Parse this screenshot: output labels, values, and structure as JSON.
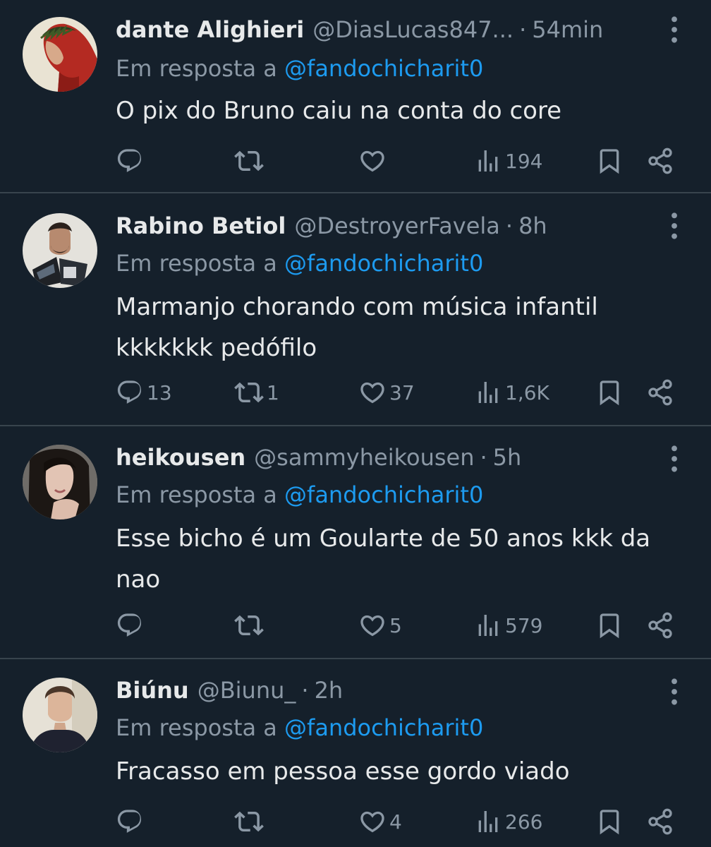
{
  "reply_prefix": "Em resposta a",
  "colors": {
    "background": "#15202b",
    "text": "#e7e9ea",
    "muted": "#8b98a5",
    "accent": "#1d9bf0",
    "divider": "#38444d"
  },
  "tweets": [
    {
      "name": "dante Alighieri",
      "handle": "@DiasLucas847...",
      "time": "54min",
      "reply_to": "@fandochicharit0",
      "lines": [
        "O pix do Bruno caiu na conta do core"
      ],
      "replies": "",
      "retweets": "",
      "likes": "",
      "views": "194",
      "avatar": "dante-portrait"
    },
    {
      "name": "Rabino Betiol",
      "handle": "@DestroyerFavela",
      "time": "8h",
      "reply_to": "@fandochicharit0",
      "lines": [
        "Marmanjo chorando com música infantil",
        "kkkkkkk pedófilo"
      ],
      "replies": "13",
      "retweets": "1",
      "likes": "37",
      "views": "1,6K",
      "avatar": "man-reading-book"
    },
    {
      "name": "heikousen",
      "handle": "@sammyheikousen",
      "time": "5h",
      "reply_to": "@fandochicharit0",
      "lines": [
        "Esse bicho é um Goularte de 50 anos kkk da",
        "nao"
      ],
      "replies": "",
      "retweets": "",
      "likes": "5",
      "views": "579",
      "avatar": "woman-portrait"
    },
    {
      "name": "Biúnu",
      "handle": "@Biunu_",
      "time": "2h",
      "reply_to": "@fandochicharit0",
      "lines": [
        "Fracasso em pessoa esse gordo viado"
      ],
      "replies": "",
      "retweets": "",
      "likes": "4",
      "views": "266",
      "avatar": "young-man-portrait"
    }
  ]
}
